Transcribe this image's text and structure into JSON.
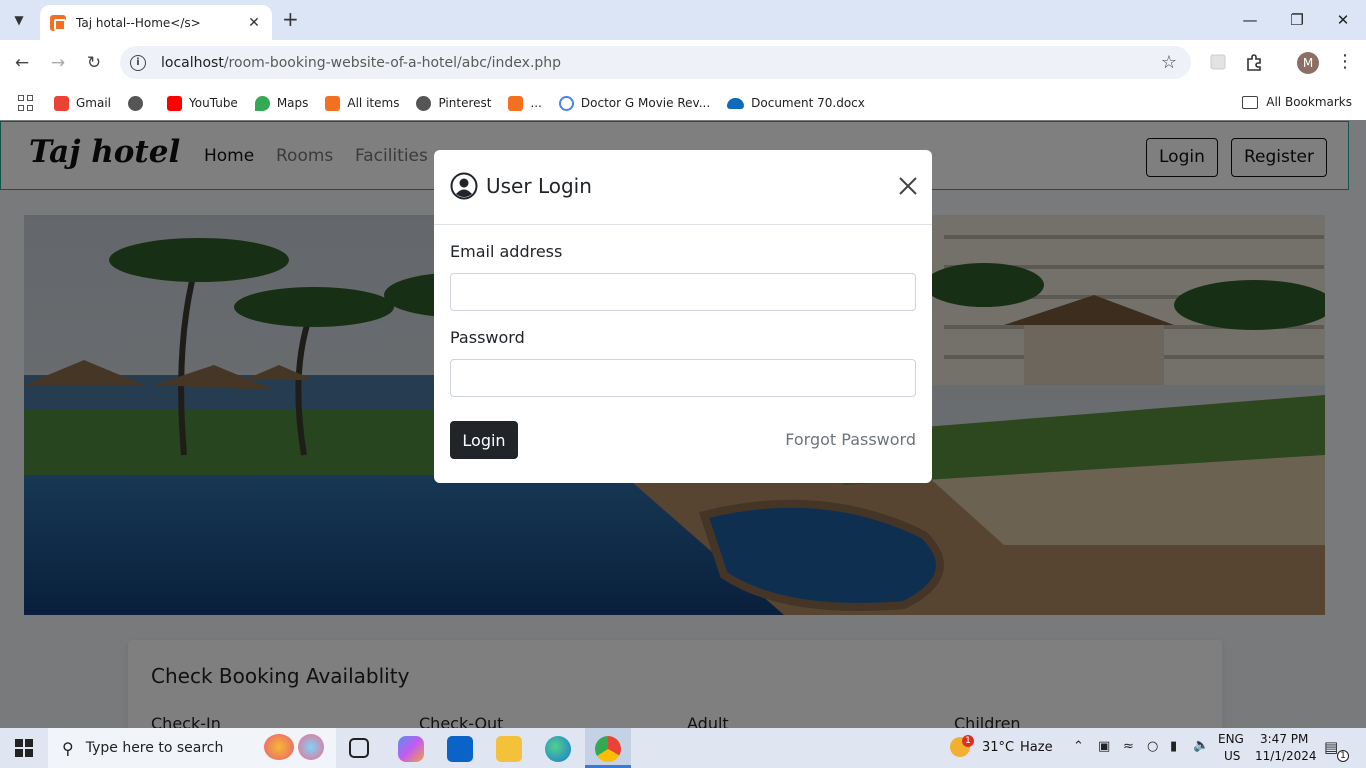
{
  "browser": {
    "tab_title": "Taj hotal--Home</s>",
    "url_host": "localhost",
    "url_path": "/room-booking-website-of-a-hotel/abc/index.php",
    "profile_initial": "M",
    "bookmarks": [
      {
        "label": "Gmail",
        "icon": "gmail-icon",
        "color": "#ea4335"
      },
      {
        "label": "",
        "icon": "globe-icon",
        "color": "#555555"
      },
      {
        "label": "YouTube",
        "icon": "youtube-icon",
        "color": "#ff0000"
      },
      {
        "label": "Maps",
        "icon": "maps-icon",
        "color": "#34a853"
      },
      {
        "label": "All items",
        "icon": "xampp-icon",
        "color": "#f37021"
      },
      {
        "label": "Pinterest",
        "icon": "globe-icon",
        "color": "#555555"
      },
      {
        "label": "...",
        "icon": "xampp-icon",
        "color": "#f37021"
      },
      {
        "label": "Doctor G Movie Rev...",
        "icon": "google-icon",
        "color": "#4285f4"
      },
      {
        "label": "Document 70.docx",
        "icon": "onedrive-icon",
        "color": "#0f6cbd"
      }
    ],
    "all_bookmarks": "All Bookmarks"
  },
  "site": {
    "brand": "Taj hotel",
    "nav": [
      "Home",
      "Rooms",
      "Facilities"
    ],
    "login_label": "Login",
    "register_label": "Register"
  },
  "booking": {
    "title": "Check Booking Availablity",
    "fields": [
      "Check-In",
      "Check-Out",
      "Adult",
      "Children"
    ]
  },
  "modal": {
    "title": "User Login",
    "email_label": "Email address",
    "email_value": "",
    "password_label": "Password",
    "password_value": "",
    "login_button": "Login",
    "forgot_link": "Forgot Password"
  },
  "taskbar": {
    "search_placeholder": "Type here to search",
    "weather_badge": "1",
    "temperature": "31°C",
    "weather": "Haze",
    "lang": "ENG",
    "region": "US",
    "time": "3:47 PM",
    "date": "11/1/2024",
    "notification_count": "1"
  },
  "colors": {
    "accent_teal": "#27a59a",
    "dark_button": "#212529",
    "taskbar_active": "#3b78d8"
  }
}
